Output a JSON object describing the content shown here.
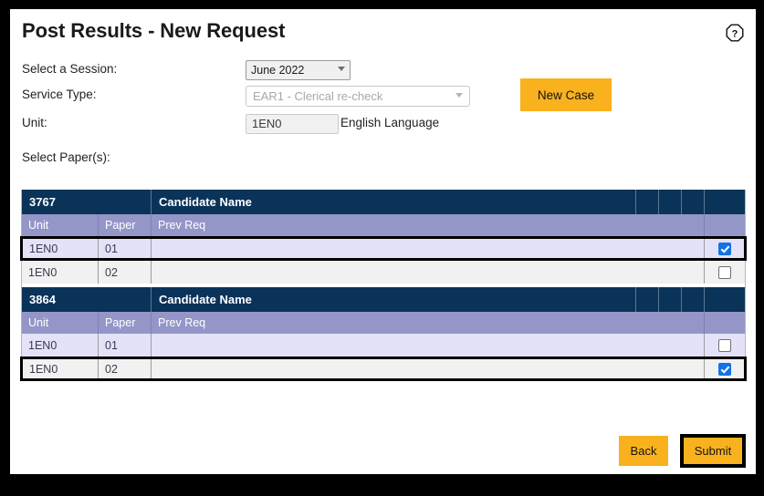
{
  "header": {
    "title": "Post Results - New Request",
    "help_icon": "question-mark-octagon-icon"
  },
  "form": {
    "session": {
      "label": "Select a Session:",
      "value": "June 2022"
    },
    "service_type": {
      "label": "Service Type:",
      "value": "EAR1 - Clerical re-check"
    },
    "unit": {
      "label": "Unit:",
      "value": "1EN0",
      "description": "English Language"
    },
    "new_case_button": "New Case",
    "select_papers_label": "Select Paper(s):"
  },
  "table": {
    "candidate_name_header": "Candidate Name",
    "columns": [
      "Unit",
      "Paper",
      "Prev Req"
    ],
    "sections": [
      {
        "candidate_number": "3767",
        "candidate_name": "",
        "rows": [
          {
            "unit": "1EN0",
            "paper": "01",
            "prev_req": "",
            "checked": true,
            "selected": true,
            "shade": "lavender"
          },
          {
            "unit": "1EN0",
            "paper": "02",
            "prev_req": "",
            "checked": false,
            "selected": false,
            "shade": "grey"
          }
        ]
      },
      {
        "candidate_number": "3864",
        "candidate_name": "",
        "rows": [
          {
            "unit": "1EN0",
            "paper": "01",
            "prev_req": "",
            "checked": false,
            "selected": false,
            "shade": "lavender"
          },
          {
            "unit": "1EN0",
            "paper": "02",
            "prev_req": "",
            "checked": true,
            "selected": true,
            "shade": "grey"
          }
        ]
      }
    ]
  },
  "footer": {
    "back_button": "Back",
    "submit_button": "Submit"
  },
  "colors": {
    "accent_amber": "#f9b11e",
    "header_navy": "#0a3359",
    "subheader_purple": "#9496c8",
    "row_lavender": "#e4e2f8",
    "row_grey": "#f1f1f1",
    "checkbox_blue": "#1273e6",
    "focus_outline": "#000000"
  }
}
